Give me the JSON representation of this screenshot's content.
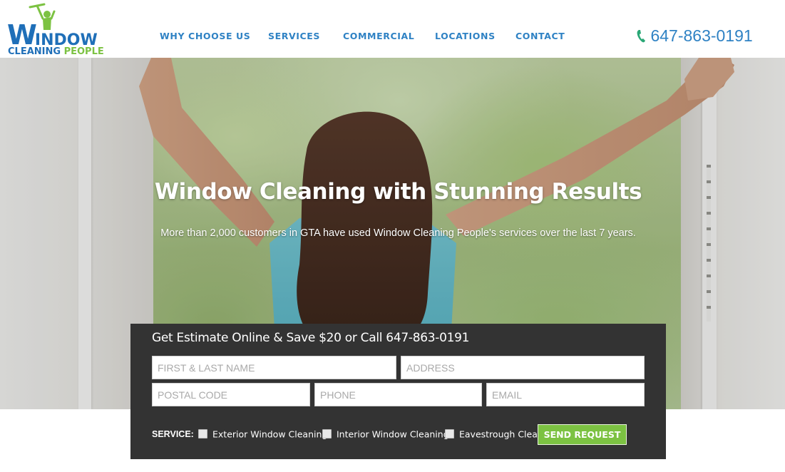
{
  "brand": {
    "logo_big_letter": "W",
    "logo_word_rest": "INDOW",
    "logo_line2_part1": "CLEANING",
    "logo_line2_part2": "PEOPLE",
    "colors": {
      "blue": "#1f6fb8",
      "green": "#7cc242",
      "nav": "#2f82c4",
      "form_bg": "#333333"
    }
  },
  "nav": {
    "items": [
      {
        "label": "WHY CHOOSE US"
      },
      {
        "label": "SERVICES"
      },
      {
        "label": "COMMERCIAL"
      },
      {
        "label": "LOCATIONS"
      },
      {
        "label": "CONTACT"
      }
    ]
  },
  "header": {
    "phone_icon": "phone-icon",
    "phone": "647-863-0191"
  },
  "hero": {
    "title": "Window Cleaning with Stunning Results",
    "subtitle": "More than 2,000 customers in GTA have used Window Cleaning People's services over the last 7 years."
  },
  "form": {
    "title": "Get Estimate Online & Save $20 or Call 647-863-0191",
    "placeholders": {
      "name": "FIRST & LAST NAME",
      "address": "ADDRESS",
      "postal": "POSTAL CODE",
      "phone": "PHONE",
      "email": "EMAIL"
    },
    "service_label": "SERVICE:",
    "services": [
      {
        "label": "Exterior Window Cleaning",
        "checked": false
      },
      {
        "label": "Interior Window Cleaning",
        "checked": false
      },
      {
        "label": "Eavestrough Cleaning",
        "checked": false
      }
    ],
    "submit_label": "SEND REQUEST"
  }
}
